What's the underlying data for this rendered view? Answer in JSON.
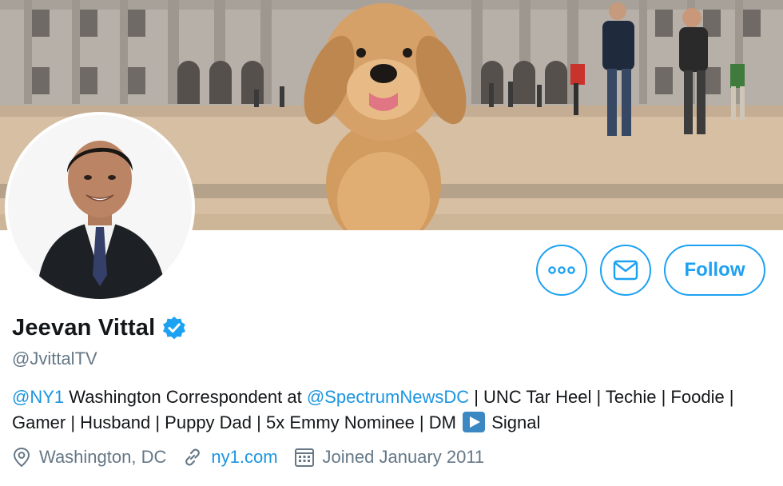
{
  "profile": {
    "name": "Jeevan Vittal",
    "handle": "@JvittalTV",
    "verified": true
  },
  "bio": {
    "mention_1": "@NY1",
    "text_1": " Washington Correspondent at ",
    "mention_2": "@SpectrumNewsDC",
    "text_2": " | UNC Tar Heel | Techie | Foodie | Gamer | Husband | Puppy Dad | 5x Emmy Nominee | DM ",
    "emoji": "play-button-emoji",
    "text_3": " Signal"
  },
  "meta": {
    "location": "Washington, DC",
    "website": "ny1.com",
    "joined": "Joined January 2011"
  },
  "actions": {
    "follow_label": "Follow",
    "more_icon": "more-dots-icon",
    "message_icon": "envelope-icon"
  },
  "colors": {
    "accent": "#1da1f2",
    "link": "#1b95e0",
    "text_primary": "#14171a",
    "text_secondary": "#657786",
    "verified_badge": "#1da1f2"
  }
}
